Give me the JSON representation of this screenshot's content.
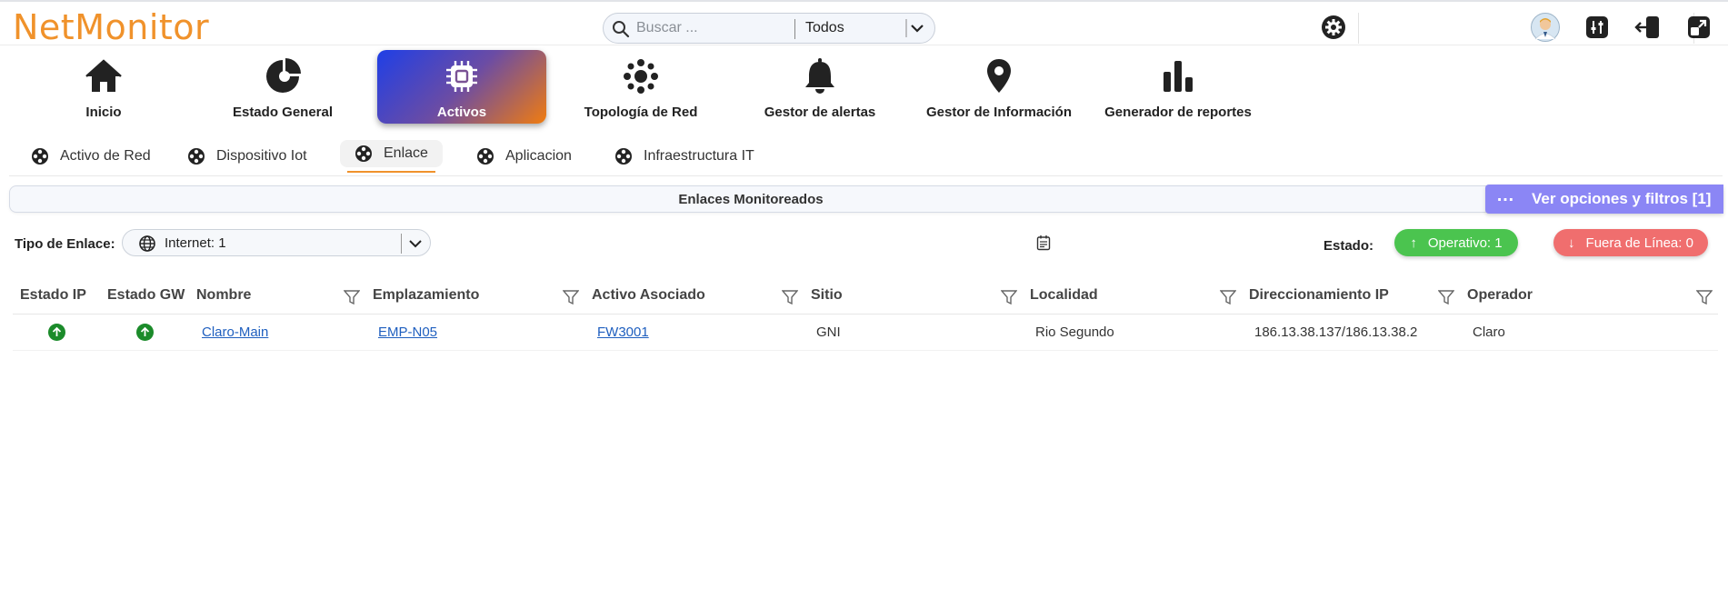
{
  "app": {
    "logo": "NetMonitor"
  },
  "search": {
    "placeholder": "Buscar ...",
    "scope": "Todos"
  },
  "header_icons": [
    "gear-icon",
    "user-avatar",
    "equalizer-icon",
    "logout-icon",
    "expand-icon"
  ],
  "main_nav": [
    {
      "label": "Inicio",
      "icon": "home-icon",
      "active": false
    },
    {
      "label": "Estado General",
      "icon": "chart-pie-icon",
      "active": false
    },
    {
      "label": "Activos",
      "icon": "chip-icon",
      "active": true
    },
    {
      "label": "Topología de Red",
      "icon": "network-icon",
      "active": false
    },
    {
      "label": "Gestor de alertas",
      "icon": "bell-icon",
      "active": false
    },
    {
      "label": "Gestor de Información",
      "icon": "location-icon",
      "active": false
    },
    {
      "label": "Generador de reportes",
      "icon": "bar-chart-icon",
      "active": false
    }
  ],
  "sub_nav": [
    {
      "label": "Activo de Red",
      "active": false
    },
    {
      "label": "Dispositivo Iot",
      "active": false
    },
    {
      "label": "Enlace",
      "active": true
    },
    {
      "label": "Aplicacion",
      "active": false
    },
    {
      "label": "Infraestructura IT",
      "active": false
    }
  ],
  "section_title": "Enlaces Monitoreados",
  "options_button": "Ver opciones y filtros [1]",
  "filters": {
    "type_label": "Tipo de Enlace:",
    "type_value": "Internet: 1",
    "estado_label": "Estado:",
    "operativo": "Operativo: 1",
    "fuera_de_linea": "Fuera de Línea: 0"
  },
  "colors": {
    "brand": "#f0922b",
    "ok": "#4bc44f",
    "down": "#f06e6e",
    "options": "#8b86f5",
    "status_up": "#1b8b2a"
  },
  "table": {
    "columns": [
      "Estado IP",
      "Estado GW",
      "Nombre",
      "Emplazamiento",
      "Activo Asociado",
      "Sitio",
      "Localidad",
      "Direccionamiento IP",
      "Operador"
    ],
    "rows": [
      {
        "estado_ip": "up",
        "estado_gw": "up",
        "nombre": "Claro-Main",
        "emplazamiento": "EMP-N05",
        "activo": "FW3001",
        "sitio": "GNI",
        "localidad": "Rio Segundo",
        "ip": "186.13.38.137/186.13.38.2",
        "operador": "Claro"
      }
    ]
  }
}
